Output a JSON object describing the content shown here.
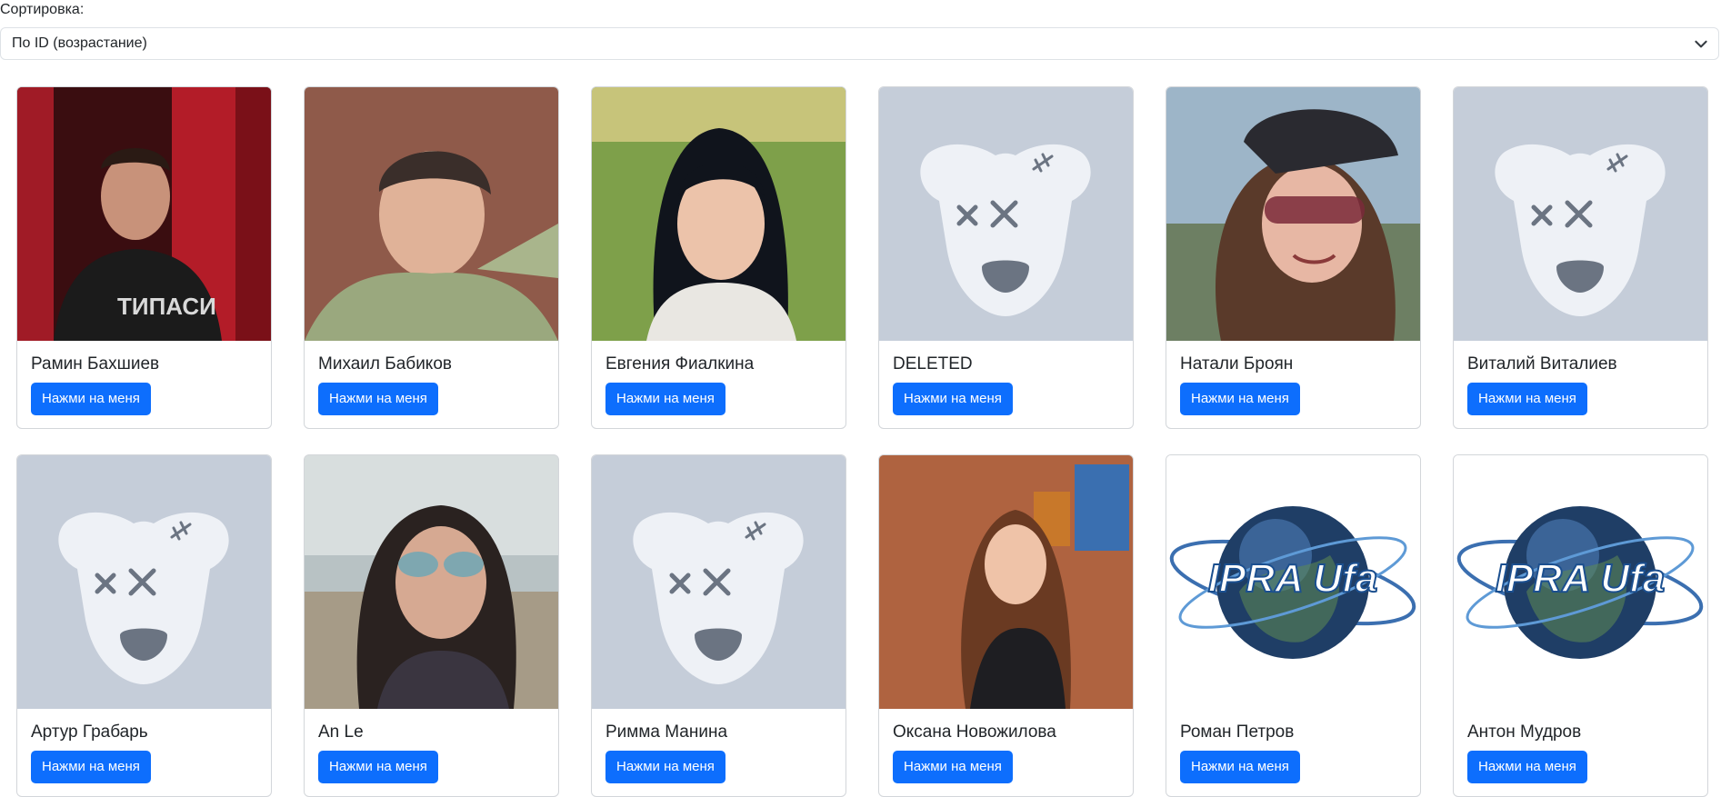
{
  "sort": {
    "label": "Сортировка:",
    "selected": "По ID (возрастание)"
  },
  "users": [
    {
      "name": "Рамин Бахшиев",
      "photo": "photo-man-red-curtains",
      "button": "Нажми на меня"
    },
    {
      "name": "Михаил Бабиков",
      "photo": "photo-man-beanie",
      "button": "Нажми на меня"
    },
    {
      "name": "Евгения Фиалкина",
      "photo": "photo-woman-grass",
      "button": "Нажми на меня"
    },
    {
      "name": "DELETED",
      "photo": "deleted-dog-avatar",
      "button": "Нажми на меня"
    },
    {
      "name": "Натали Броян",
      "photo": "photo-woman-cap-sunglasses",
      "button": "Нажми на меня"
    },
    {
      "name": "Виталий Виталиев",
      "photo": "deleted-dog-avatar",
      "button": "Нажми на меня"
    },
    {
      "name": "Артур Грабарь",
      "photo": "deleted-dog-avatar",
      "button": "Нажми на меня"
    },
    {
      "name": "An Le",
      "photo": "photo-woman-aviators",
      "button": "Нажми на меня"
    },
    {
      "name": "Римма Манина",
      "photo": "deleted-dog-avatar",
      "button": "Нажми на меня"
    },
    {
      "name": "Оксана Новожилова",
      "photo": "photo-woman-brick-wall",
      "button": "Нажми на меня"
    },
    {
      "name": "Роман Петров",
      "photo": "globe-logo",
      "button": "Нажми на меня"
    },
    {
      "name": "Антон Мудров",
      "photo": "globe-logo",
      "button": "Нажми на меня"
    }
  ]
}
